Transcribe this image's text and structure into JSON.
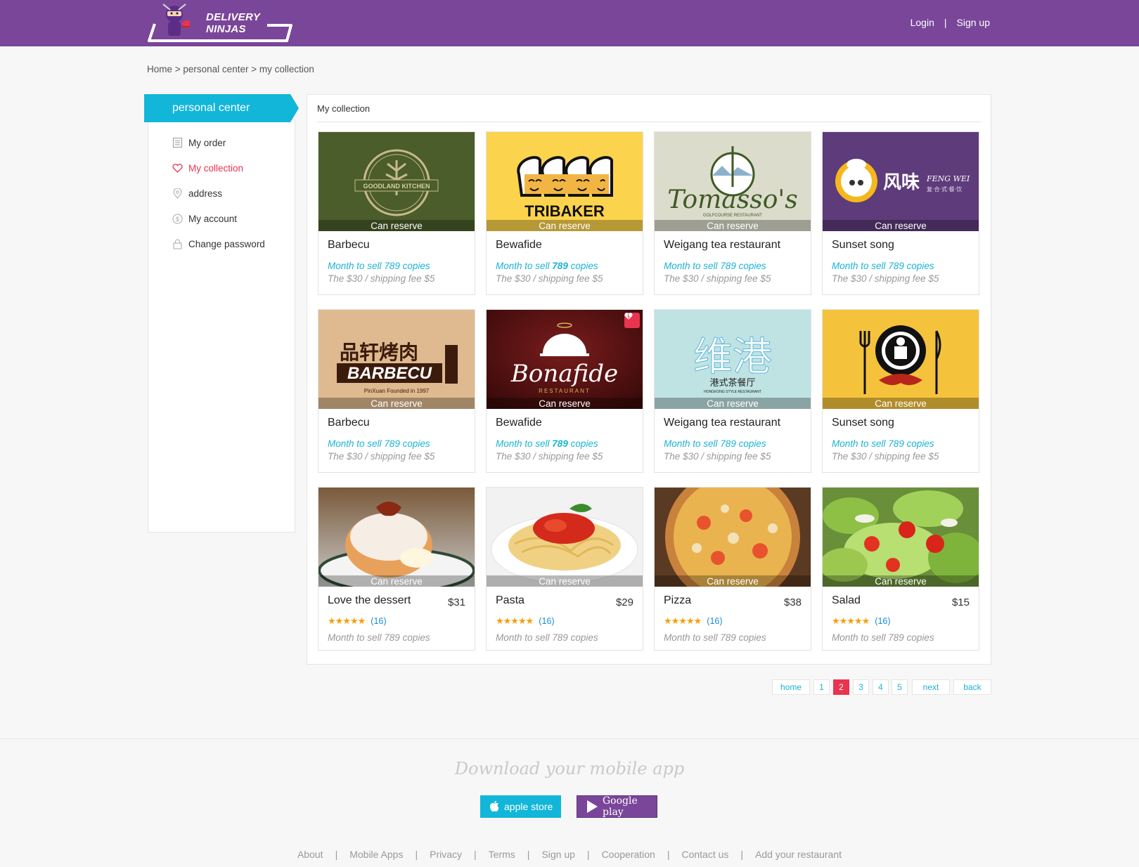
{
  "header": {
    "logo_text": "DELIVERY NINJAS",
    "login": "Login",
    "separator": "|",
    "signup": "Sign up"
  },
  "breadcrumb": "Home > personal center > my collection",
  "sidebar": {
    "title": "personal center",
    "items": [
      {
        "label": "My order",
        "icon": "list-icon"
      },
      {
        "label": "My collection",
        "icon": "heart-icon",
        "active": true
      },
      {
        "label": "address",
        "icon": "location-pin-icon"
      },
      {
        "label": "My account",
        "icon": "dollar-coin-icon"
      },
      {
        "label": "Change password",
        "icon": "lock-icon"
      }
    ]
  },
  "main": {
    "title": "My collection",
    "reserve_label": "Can reserve",
    "restaurants": [
      {
        "name": "Barbecu",
        "sold_prefix": "Month to sell ",
        "sold_num": "789",
        "sold_suffix": " copies",
        "fee": "The $30 / shipping fee $5",
        "logo": "GOODLAND KITCHEN",
        "bg": "#4a5d2a"
      },
      {
        "name": "Bewafide",
        "sold_prefix": "Month to sell ",
        "sold_num": "789",
        "sold_suffix": " copies",
        "fee": "The $30 / shipping fee $5",
        "logo": "TRIBAKER",
        "bg": "#fcd34d"
      },
      {
        "name": "Weigang tea restaurant",
        "sold_prefix": "Month to sell ",
        "sold_num": "789",
        "sold_suffix": " copies",
        "fee": "The $30 / shipping fee $5",
        "logo": "Tomasso's",
        "logo_sub": "GOLFCOURSE RESTAURANT",
        "bg": "#dcdccc"
      },
      {
        "name": "Sunset song",
        "sold_prefix": "Month to sell ",
        "sold_num": "789",
        "sold_suffix": " copies",
        "fee": "The $30 / shipping fee $5",
        "logo": "风味",
        "logo_sub": "FENG WEI",
        "logo_sub2": "复·合·式·餐·饮",
        "bg": "#5e3b7a"
      },
      {
        "name": "Barbecu",
        "sold_prefix": "Month to sell ",
        "sold_num": "789",
        "sold_suffix": " copies",
        "fee": "The $30 / shipping fee $5",
        "logo": "品轩烤肉",
        "logo_sub": "BARBECU",
        "logo_sub2": "PinXuan Founded in 1997",
        "bg": "#dfb98f"
      },
      {
        "name": "Bewafide",
        "sold_prefix": "Month to sell ",
        "sold_num": "789",
        "sold_suffix": " copies",
        "fee": "The $30 / shipping fee $5",
        "logo": "Bonafide",
        "logo_sub": "RESTAURANT",
        "bg": "#5a1212"
      },
      {
        "name": "Weigang tea restaurant",
        "sold_prefix": "Month to sell ",
        "sold_num": "789",
        "sold_suffix": " copies",
        "fee": "The $30 / shipping fee $5",
        "logo": "维港",
        "logo_sub": "港式茶餐厅",
        "logo_sub2": "HONGKONG STYLE RESTAURANT",
        "bg": "#bfe3e2"
      },
      {
        "name": "Sunset song",
        "sold_prefix": "Month to sell ",
        "sold_num": "789",
        "sold_suffix": " copies",
        "fee": "The $30 / shipping fee $5",
        "logo": "",
        "bg": "#f5c33b"
      }
    ],
    "dishes": [
      {
        "name": "Love the dessert",
        "price": "$31",
        "rating": 5,
        "reviews": "(16)",
        "sold": "Month to sell 789 copies"
      },
      {
        "name": "Pasta",
        "price": "$29",
        "rating": 5,
        "reviews": "(16)",
        "sold": "Month to sell 789 copies"
      },
      {
        "name": "Pizza",
        "price": "$38",
        "rating": 5,
        "reviews": "(16)",
        "sold": "Month to sell 789 copies"
      },
      {
        "name": "Salad",
        "price": "$15",
        "rating": 5,
        "reviews": "(16)",
        "sold": "Month to sell 789 copies"
      }
    ],
    "stars": "★★★★★"
  },
  "pagination": {
    "items": [
      "home",
      "1",
      "2",
      "3",
      "4",
      "5",
      "next",
      "back"
    ],
    "current": "2"
  },
  "footer": {
    "download_title": "Download your mobile app",
    "apple_label": "apple store",
    "google_label": "Google play",
    "links": [
      "About",
      "Mobile Apps",
      "Privacy",
      "Terms",
      "Sign up",
      "Cooperation",
      "Contact us",
      "Add your restaurant"
    ],
    "link_separator": "|"
  },
  "colors": {
    "brand_purple": "#7a4699",
    "accent_cyan": "#12b6d8",
    "active_red": "#e8344e",
    "star_orange": "#f5a00b"
  }
}
